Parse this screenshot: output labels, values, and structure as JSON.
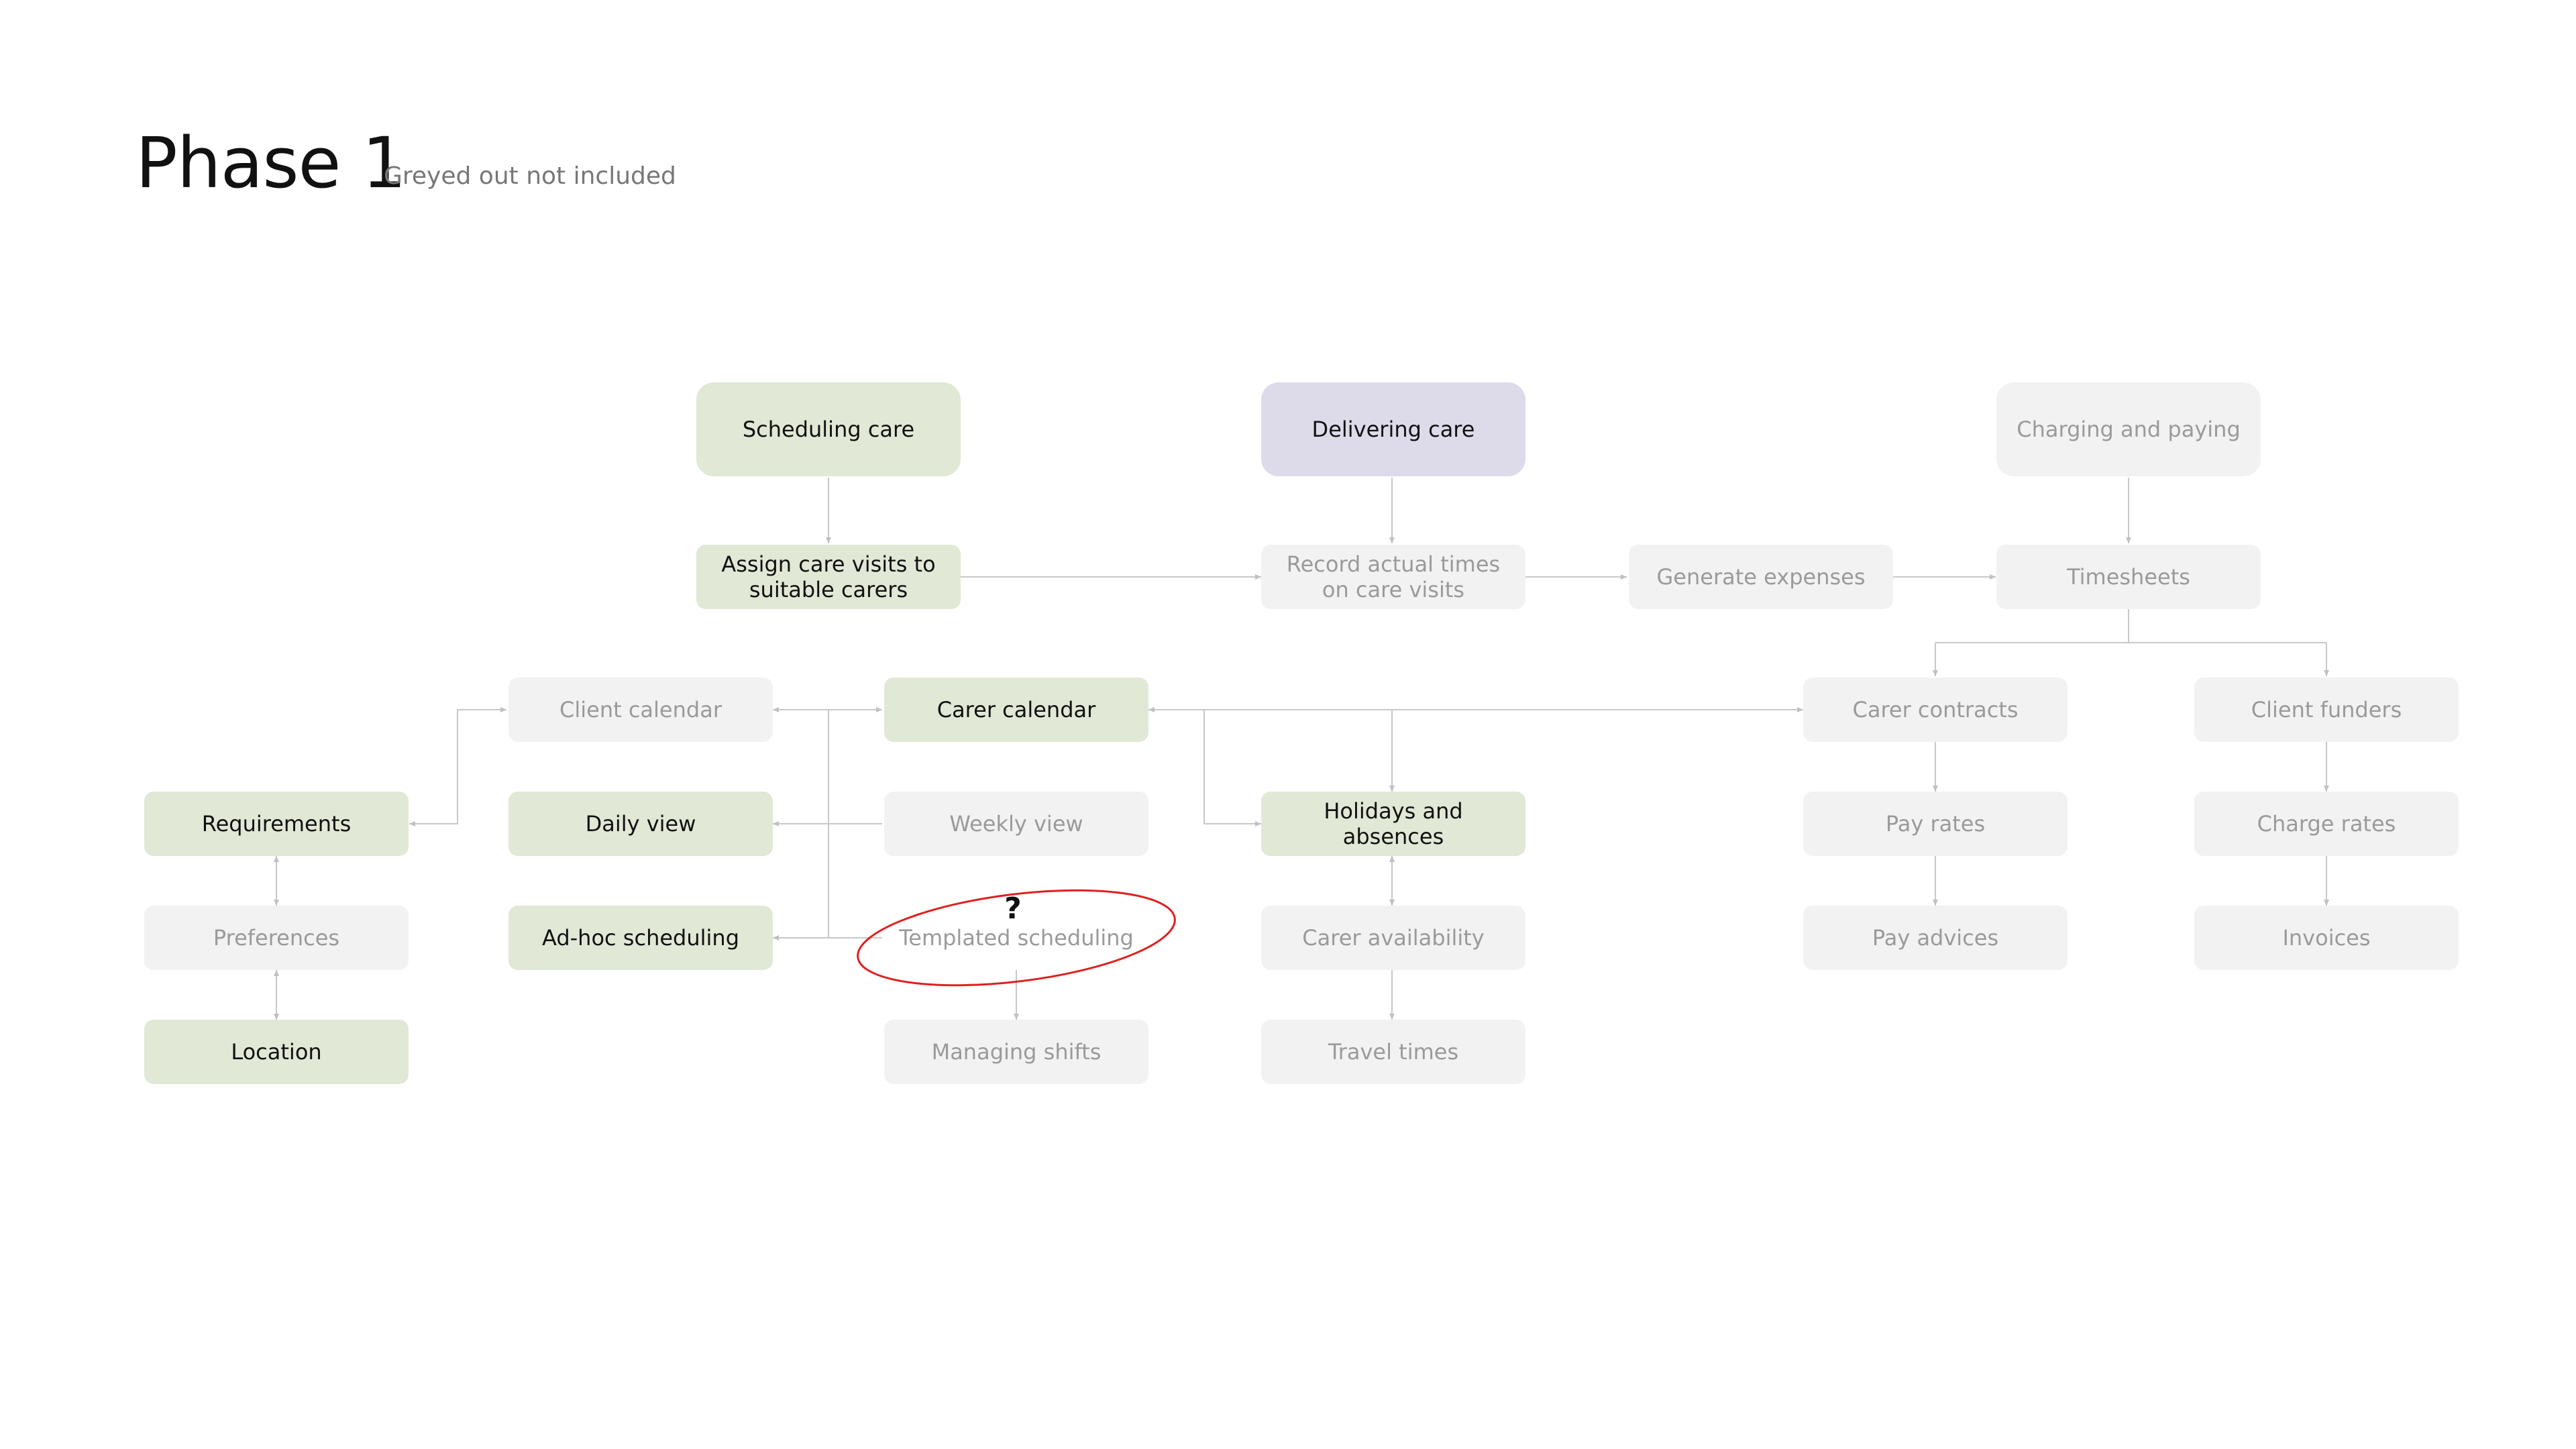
{
  "header": {
    "title": "Phase 1",
    "subtitle": "Greyed out not included"
  },
  "diagram": {
    "annotation": "?",
    "colors": {
      "included": "#e1e8d5",
      "delivering": "#dddbea",
      "excluded": "#f2f2f2",
      "excluded_text": "#9a9a9a",
      "connector": "#c8c8c8",
      "highlight_ring": "#e02020"
    },
    "nodes": {
      "scheduling_care": "Scheduling care",
      "delivering_care": "Delivering care",
      "charging_and_paying": "Charging and paying",
      "assign_care_visits": "Assign care visits to suitable carers",
      "record_actual_times": "Record actual times on care visits",
      "generate_expenses": "Generate expenses",
      "timesheets": "Timesheets",
      "client_calendar": "Client calendar",
      "carer_calendar": "Carer calendar",
      "carer_contracts": "Carer contracts",
      "client_funders": "Client funders",
      "requirements": "Requirements",
      "daily_view": "Daily view",
      "weekly_view": "Weekly view",
      "holidays_and_absences": "Holidays and absences",
      "pay_rates": "Pay rates",
      "charge_rates": "Charge rates",
      "preferences": "Preferences",
      "ad_hoc_scheduling": "Ad-hoc scheduling",
      "templated_scheduling": "Templated scheduling",
      "carer_availability": "Carer availability",
      "pay_advices": "Pay advices",
      "invoices": "Invoices",
      "location": "Location",
      "managing_shifts": "Managing shifts",
      "travel_times": "Travel times"
    }
  }
}
